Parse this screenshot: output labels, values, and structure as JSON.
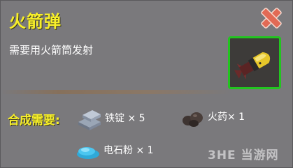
{
  "item": {
    "title": "火箭弹",
    "description": "需要用火箭筒发射",
    "icon": "rocket-shell-icon"
  },
  "recipe": {
    "label": "合成需要:",
    "materials": [
      {
        "name": "铁锭",
        "qty": "× 5",
        "icon": "iron-ingot-icon"
      },
      {
        "name": "火药",
        "qty": "× 1",
        "icon": "gunpowder-icon"
      },
      {
        "name": "电石粉",
        "qty": "× 1",
        "icon": "carbide-powder-icon"
      }
    ]
  },
  "window": {
    "close_icon": "close-icon"
  },
  "watermark": {
    "text": "3HE 当游网"
  },
  "colors": {
    "title": "#f7ef2a",
    "panel": "#7a797c",
    "frame": "#22c51f",
    "close": "#e26a55"
  }
}
